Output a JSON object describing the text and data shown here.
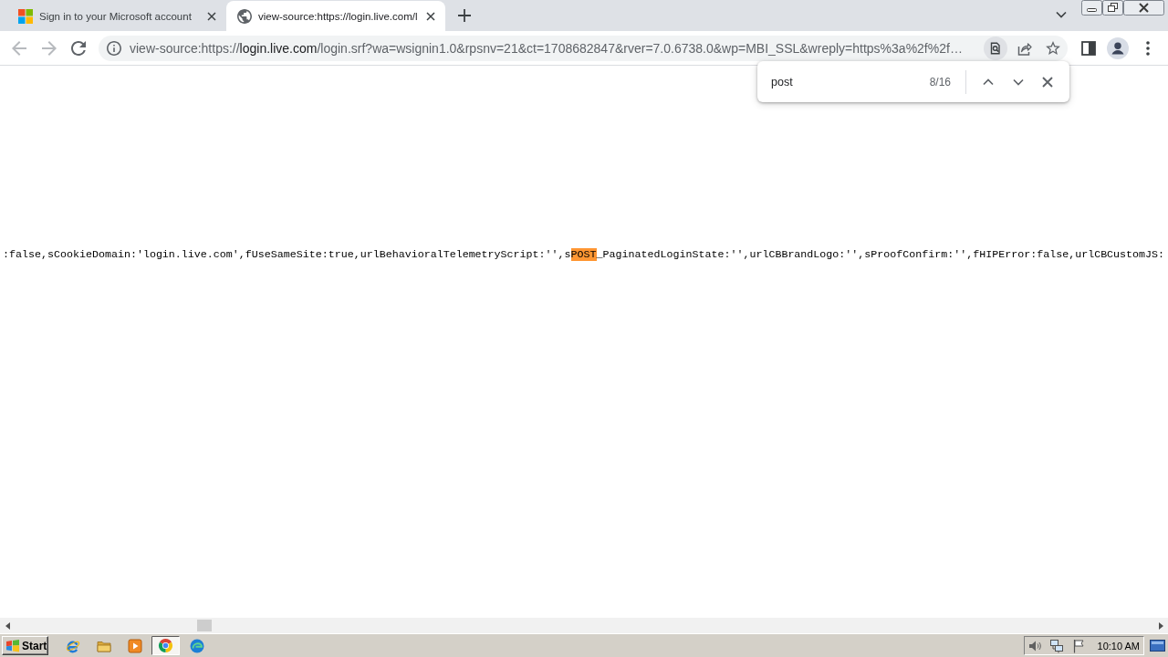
{
  "tabs": [
    {
      "title": "Sign in to your Microsoft account",
      "kind": "site",
      "selected": false
    },
    {
      "title": "view-source:https://login.live.com/l",
      "kind": "generic",
      "selected": true
    }
  ],
  "toolbar": {
    "back": {
      "disabled": true
    },
    "forward": {
      "disabled": true
    },
    "url": {
      "scheme": "view-source:https://",
      "host": "login.live.com",
      "path": "/login.srf?wa=wsignin1.0&rpsnv=21&ct=1708682847&rver=7.0.6738.0&wp=MBI_SSL&wreply=https%3a%2f%2f…"
    }
  },
  "find_bar": {
    "query": "post",
    "count": "8/16"
  },
  "source_view": {
    "segments": [
      {
        "text": ":false,sCookieDomain:'login.live.com',fUseSameSite:true,urlBehavioralTelemetryScript:'',s",
        "highlighted": false
      },
      {
        "text": "POST",
        "highlighted": true
      },
      {
        "text": "_PaginatedLoginState:'',urlCBBrandLogo:'',sProofConfirm:'',fHIPError:false,urlCBCustomJS:",
        "highlighted": false
      }
    ]
  },
  "taskbar": {
    "start_label": "Start",
    "apps": [
      {
        "kind": "ebrowser",
        "selected": false
      },
      {
        "kind": "folder",
        "selected": false
      },
      {
        "kind": "player",
        "selected": false
      },
      {
        "kind": "ring",
        "selected": true
      },
      {
        "kind": "swirl",
        "selected": false
      }
    ],
    "clock": "10:10 AM"
  }
}
